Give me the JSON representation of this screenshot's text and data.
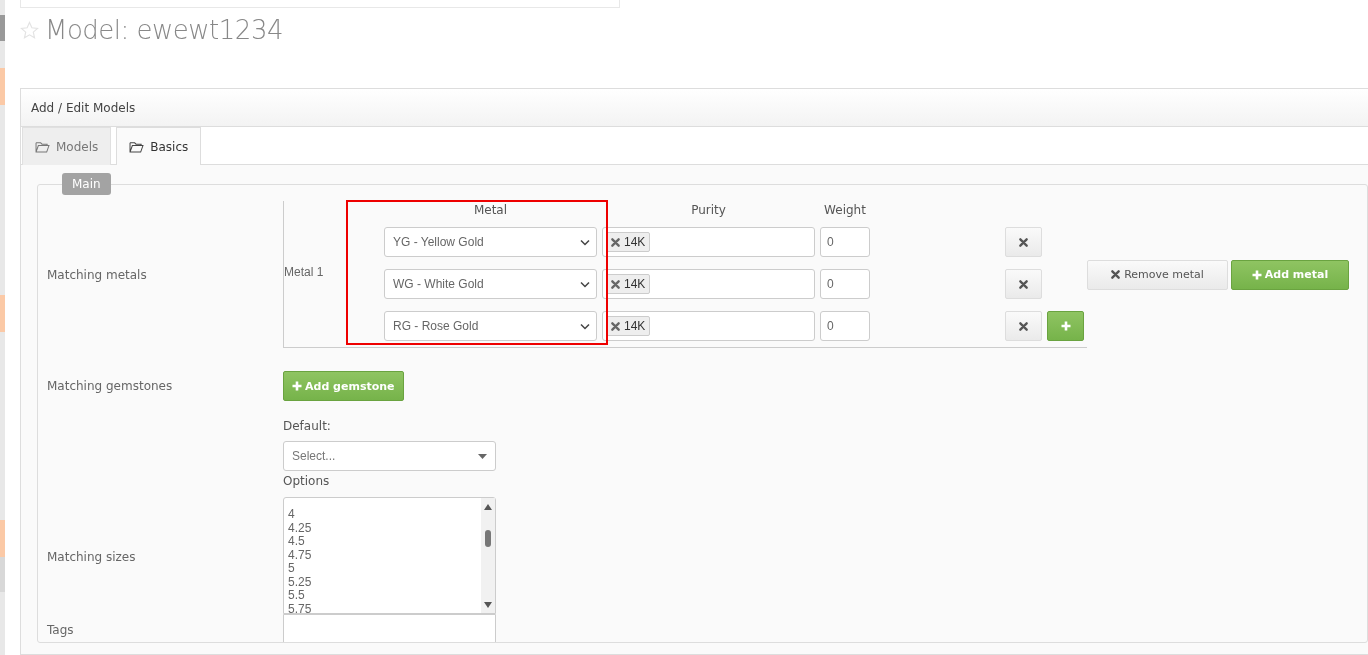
{
  "page_title": {
    "text": "Model: ewewt1234",
    "starred": false
  },
  "panel": {
    "title": "Add / Edit Models"
  },
  "tabs": [
    {
      "label": "Models",
      "selected": false
    },
    {
      "label": "Basics",
      "selected": true
    }
  ],
  "section": {
    "legend": "Main"
  },
  "matching_metals": {
    "label": "Matching metals",
    "group_label": "Metal 1",
    "columns": [
      "Metal",
      "Purity",
      "Weight"
    ],
    "rows": [
      {
        "metal": "YG - Yellow Gold",
        "purity_tags": [
          "14K"
        ],
        "weight": "0",
        "add_button": false
      },
      {
        "metal": "WG - White Gold",
        "purity_tags": [
          "14K"
        ],
        "weight": "0",
        "add_button": false
      },
      {
        "metal": "RG - Rose Gold",
        "purity_tags": [
          "14K"
        ],
        "weight": "0",
        "add_button": true
      }
    ],
    "remove_button": "Remove metal",
    "add_button": "Add metal"
  },
  "matching_gemstones": {
    "label": "Matching gemstones",
    "add_button": "Add gemstone"
  },
  "matching_sizes": {
    "label": "Matching sizes",
    "default_label": "Default:",
    "default_placeholder": "Select...",
    "options_label": "Options",
    "options": [
      "4",
      "4.25",
      "4.5",
      "4.75",
      "5",
      "5.25",
      "5.5",
      "5.75"
    ]
  },
  "tags": {
    "label": "Tags"
  }
}
